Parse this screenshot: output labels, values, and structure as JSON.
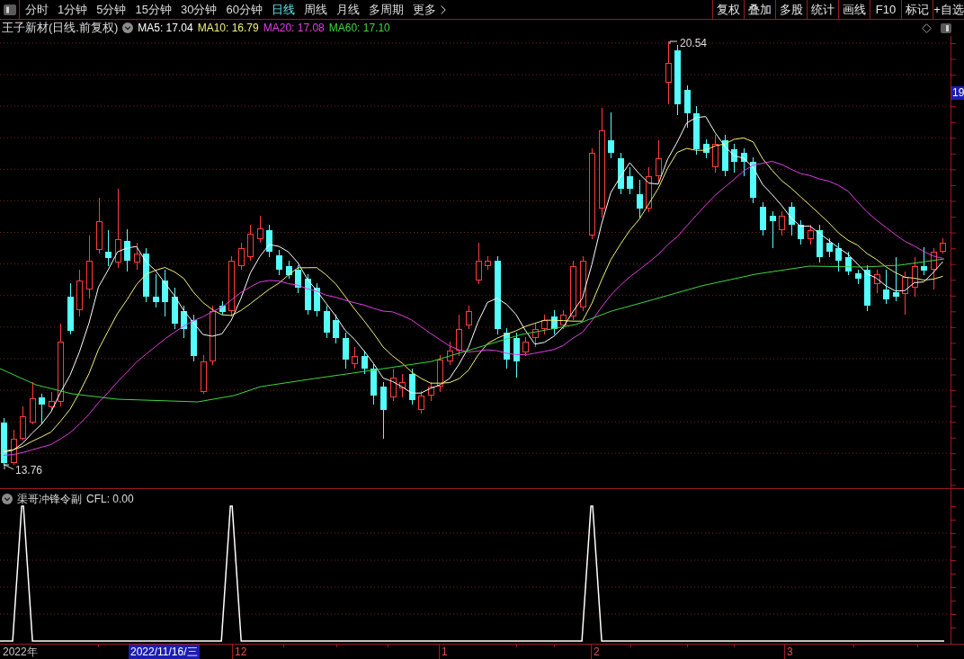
{
  "toolbar": {
    "periods": [
      {
        "label": "分时",
        "kind": "period",
        "selected": false
      },
      {
        "label": "1分钟",
        "kind": "period",
        "selected": false
      },
      {
        "label": "5分钟",
        "kind": "period",
        "selected": false
      },
      {
        "label": "15分钟",
        "kind": "period",
        "selected": false
      },
      {
        "label": "30分钟",
        "kind": "period",
        "selected": false
      },
      {
        "label": "60分钟",
        "kind": "period",
        "selected": false
      },
      {
        "label": "日线",
        "kind": "period",
        "selected": true
      },
      {
        "label": "周线",
        "kind": "period",
        "selected": false
      },
      {
        "label": "月线",
        "kind": "period",
        "selected": false
      },
      {
        "label": "多周期",
        "kind": "period",
        "selected": false
      },
      {
        "label": "更多",
        "kind": "menu",
        "selected": false
      }
    ],
    "buttons": [
      "复权",
      "叠加",
      "多股",
      "统计",
      "画线",
      "F10",
      "标记",
      "+自选"
    ]
  },
  "main_chart": {
    "title": "王子新材(日线.前复权)",
    "moving_averages": [
      {
        "label": "MA5: 17.04",
        "color": "#ffffff"
      },
      {
        "label": "MA10: 16.79",
        "color": "#f2f27a"
      },
      {
        "label": "MA20: 17.08",
        "color": "#e23fe2"
      },
      {
        "label": "MA60: 17.10",
        "color": "#3fd63f"
      }
    ],
    "high_label": "20.54",
    "low_label": "13.76",
    "axis_label": "19"
  },
  "indicator_panel": {
    "title": "渠哥冲锋令副",
    "reading": "CFL: 0.00"
  },
  "x_axis": {
    "labels": [
      {
        "text": "2022年",
        "kind": "year"
      },
      {
        "text": "2022/11/16/三",
        "kind": "cursor"
      },
      {
        "text": "12",
        "kind": "month"
      },
      {
        "text": "1",
        "kind": "month"
      },
      {
        "text": "2",
        "kind": "month"
      },
      {
        "text": "3",
        "kind": "month"
      }
    ]
  }
}
